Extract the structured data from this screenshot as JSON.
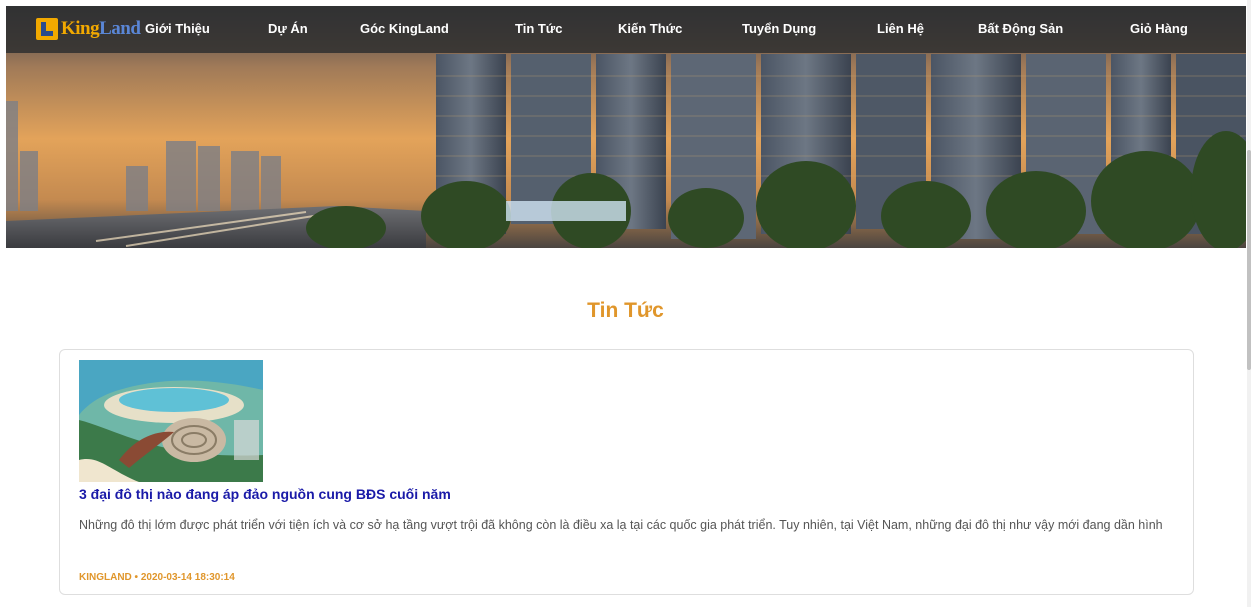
{
  "brand": {
    "logo_king": "King",
    "logo_land": "Land",
    "accent_color": "#e0962b",
    "link_color": "#1a1aa8"
  },
  "nav": {
    "items": [
      {
        "label": "Giới Thiệu"
      },
      {
        "label": "Dự Án"
      },
      {
        "label": "Góc KingLand"
      },
      {
        "label": "Tin Tức"
      },
      {
        "label": "Kiến Thức"
      },
      {
        "label": "Tuyển Dụng"
      },
      {
        "label": "Liên Hệ"
      },
      {
        "label": "Bất Động Sản"
      },
      {
        "label": "Giỏ Hàng"
      }
    ]
  },
  "main": {
    "section_title": "Tin Tức",
    "articles": [
      {
        "title": "3 đại đô thị nào đang áp đảo nguồn cung BĐS cuối năm",
        "description": "Những đô thị lớm được phát triển với tiện ích và cơ sở hạ tầng vượt trội đã không còn là điều xa lạ tại các quốc gia phát triển. Tuy nhiên, tại Việt Nam, những đại đô thị như vậy mới đang dần hình",
        "meta": "KINGLAND • 2020-03-14 18:30:14"
      }
    ]
  }
}
